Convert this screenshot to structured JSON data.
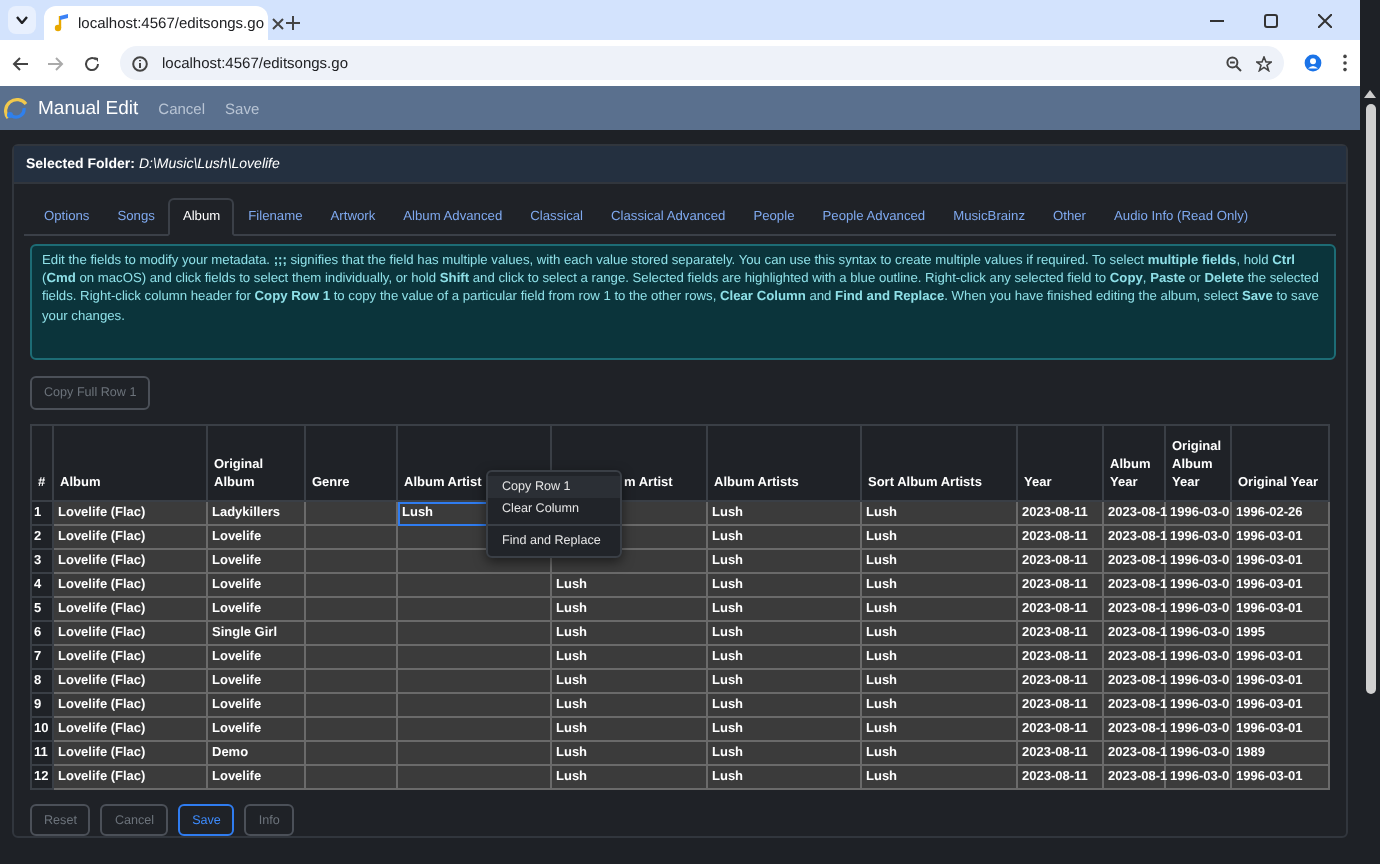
{
  "browser": {
    "tab_title": "localhost:4567/editsongs.go",
    "url": "localhost:4567/editsongs.go"
  },
  "app": {
    "title": "Manual Edit",
    "actions": [
      {
        "label": "Cancel"
      },
      {
        "label": "Save"
      }
    ]
  },
  "folder": {
    "label": "Selected Folder:",
    "path": "D:\\Music\\Lush\\Lovelife"
  },
  "tabs": [
    {
      "label": "Options",
      "selected": false
    },
    {
      "label": "Songs",
      "selected": false
    },
    {
      "label": "Album",
      "selected": true
    },
    {
      "label": "Filename",
      "selected": false
    },
    {
      "label": "Artwork",
      "selected": false
    },
    {
      "label": "Album Advanced",
      "selected": false
    },
    {
      "label": "Classical",
      "selected": false
    },
    {
      "label": "Classical Advanced",
      "selected": false
    },
    {
      "label": "People",
      "selected": false
    },
    {
      "label": "People Advanced",
      "selected": false
    },
    {
      "label": "MusicBrainz",
      "selected": false
    },
    {
      "label": "Other",
      "selected": false
    },
    {
      "label": "Audio Info (Read Only)",
      "selected": false
    }
  ],
  "info": "Edit the fields to modify your metadata. **;;;** signifies that the field has multiple values, with each value stored separately. You can use this syntax to create multiple values if required. To select **multiple fields**, hold **Ctrl** (**Cmd** on macOS) and click fields to select them individually, or hold **Shift** and click to select a range. Selected fields are highlighted with a blue outline. Right-click any selected field to **Copy**, **Paste** or **Delete** the selected fields. Right-click column header for **Copy Row 1** to copy the value of a particular field from row 1 to the other rows, **Clear Column** and **Find and Replace**. When you have finished editing the album, select **Save** to save your changes.",
  "copy_full_row_button": {
    "label": "Copy Full Row 1",
    "disabled": true
  },
  "table": {
    "number_header": "#",
    "columns": [
      "Album",
      "Original Album",
      "Genre",
      "Album Artist",
      "m Artist",
      "Album Artists",
      "Sort Album Artists",
      "Year",
      "Album Year",
      "Original Album Year",
      "Original Year"
    ],
    "rows": [
      {
        "number": "1",
        "cells": [
          {
            "text": "Lovelife  (Flac)",
            "selected": false
          },
          {
            "text": "Ladykillers",
            "selected": false
          },
          {
            "selected": false
          },
          {
            "text": "Lush",
            "selected": true
          },
          {
            "selected": false
          },
          {
            "text": "Lush",
            "selected": false
          },
          {
            "text": "Lush",
            "selected": false
          },
          {
            "text": "2023-08-11",
            "selected": false
          },
          {
            "text": "2023-08-1",
            "selected": false
          },
          {
            "text": "1996-03-0",
            "selected": false
          },
          {
            "text": "1996-02-26",
            "selected": false
          }
        ]
      },
      {
        "number": "2",
        "cells": [
          {
            "text": "Lovelife  (Flac)",
            "selected": false
          },
          {
            "text": "Lovelife",
            "selected": false
          },
          {
            "selected": false
          },
          {
            "selected": false
          },
          {
            "selected": false
          },
          {
            "text": "Lush",
            "selected": false
          },
          {
            "text": "Lush",
            "selected": false
          },
          {
            "text": "2023-08-11",
            "selected": false
          },
          {
            "text": "2023-08-1",
            "selected": false
          },
          {
            "text": "1996-03-0",
            "selected": false
          },
          {
            "text": "1996-03-01",
            "selected": false
          }
        ]
      },
      {
        "number": "3",
        "cells": [
          {
            "text": "Lovelife  (Flac)",
            "selected": false
          },
          {
            "text": "Lovelife",
            "selected": false
          },
          {
            "selected": false
          },
          {
            "selected": false
          },
          {
            "selected": false
          },
          {
            "text": "Lush",
            "selected": false
          },
          {
            "text": "Lush",
            "selected": false
          },
          {
            "text": "2023-08-11",
            "selected": false
          },
          {
            "text": "2023-08-1",
            "selected": false
          },
          {
            "text": "1996-03-0",
            "selected": false
          },
          {
            "text": "1996-03-01",
            "selected": false
          }
        ]
      },
      {
        "number": "4",
        "cells": [
          {
            "text": "Lovelife  (Flac)",
            "selected": false
          },
          {
            "text": "Lovelife",
            "selected": false
          },
          {
            "selected": false
          },
          {
            "selected": false
          },
          {
            "text": "Lush",
            "selected": false
          },
          {
            "text": "Lush",
            "selected": false
          },
          {
            "text": "Lush",
            "selected": false
          },
          {
            "text": "2023-08-11",
            "selected": false
          },
          {
            "text": "2023-08-1",
            "selected": false
          },
          {
            "text": "1996-03-0",
            "selected": false
          },
          {
            "text": "1996-03-01",
            "selected": false
          }
        ]
      },
      {
        "number": "5",
        "cells": [
          {
            "text": "Lovelife  (Flac)",
            "selected": false
          },
          {
            "text": "Lovelife",
            "selected": false
          },
          {
            "selected": false
          },
          {
            "selected": false
          },
          {
            "text": "Lush",
            "selected": false
          },
          {
            "text": "Lush",
            "selected": false
          },
          {
            "text": "Lush",
            "selected": false
          },
          {
            "text": "2023-08-11",
            "selected": false
          },
          {
            "text": "2023-08-1",
            "selected": false
          },
          {
            "text": "1996-03-0",
            "selected": false
          },
          {
            "text": "1996-03-01",
            "selected": false
          }
        ]
      },
      {
        "number": "6",
        "cells": [
          {
            "text": "Lovelife  (Flac)",
            "selected": false
          },
          {
            "text": "Single Girl",
            "selected": false
          },
          {
            "selected": false
          },
          {
            "selected": false
          },
          {
            "text": "Lush",
            "selected": false
          },
          {
            "text": "Lush",
            "selected": false
          },
          {
            "text": "Lush",
            "selected": false
          },
          {
            "text": "2023-08-11",
            "selected": false
          },
          {
            "text": "2023-08-1",
            "selected": false
          },
          {
            "text": "1996-03-0",
            "selected": false
          },
          {
            "text": "1995",
            "selected": false
          }
        ]
      },
      {
        "number": "7",
        "cells": [
          {
            "text": "Lovelife  (Flac)",
            "selected": false
          },
          {
            "text": "Lovelife",
            "selected": false
          },
          {
            "selected": false
          },
          {
            "selected": false
          },
          {
            "text": "Lush",
            "selected": false
          },
          {
            "text": "Lush",
            "selected": false
          },
          {
            "text": "Lush",
            "selected": false
          },
          {
            "text": "2023-08-11",
            "selected": false
          },
          {
            "text": "2023-08-1",
            "selected": false
          },
          {
            "text": "1996-03-0",
            "selected": false
          },
          {
            "text": "1996-03-01",
            "selected": false
          }
        ]
      },
      {
        "number": "8",
        "cells": [
          {
            "text": "Lovelife  (Flac)",
            "selected": false
          },
          {
            "text": "Lovelife",
            "selected": false
          },
          {
            "selected": false
          },
          {
            "selected": false
          },
          {
            "text": "Lush",
            "selected": false
          },
          {
            "text": "Lush",
            "selected": false
          },
          {
            "text": "Lush",
            "selected": false
          },
          {
            "text": "2023-08-11",
            "selected": false
          },
          {
            "text": "2023-08-1",
            "selected": false
          },
          {
            "text": "1996-03-0",
            "selected": false
          },
          {
            "text": "1996-03-01",
            "selected": false
          }
        ]
      },
      {
        "number": "9",
        "cells": [
          {
            "text": "Lovelife  (Flac)",
            "selected": false
          },
          {
            "text": "Lovelife",
            "selected": false
          },
          {
            "selected": false
          },
          {
            "selected": false
          },
          {
            "text": "Lush",
            "selected": false
          },
          {
            "text": "Lush",
            "selected": false
          },
          {
            "text": "Lush",
            "selected": false
          },
          {
            "text": "2023-08-11",
            "selected": false
          },
          {
            "text": "2023-08-1",
            "selected": false
          },
          {
            "text": "1996-03-0",
            "selected": false
          },
          {
            "text": "1996-03-01",
            "selected": false
          }
        ]
      },
      {
        "number": "10",
        "cells": [
          {
            "text": "Lovelife  (Flac)",
            "selected": false
          },
          {
            "text": "Lovelife",
            "selected": false
          },
          {
            "selected": false
          },
          {
            "selected": false
          },
          {
            "text": "Lush",
            "selected": false
          },
          {
            "text": "Lush",
            "selected": false
          },
          {
            "text": "Lush",
            "selected": false
          },
          {
            "text": "2023-08-11",
            "selected": false
          },
          {
            "text": "2023-08-1",
            "selected": false
          },
          {
            "text": "1996-03-0",
            "selected": false
          },
          {
            "text": "1996-03-01",
            "selected": false
          }
        ]
      },
      {
        "number": "11",
        "cells": [
          {
            "text": "Lovelife  (Flac)",
            "selected": false
          },
          {
            "text": "Demo",
            "selected": false
          },
          {
            "selected": false
          },
          {
            "selected": false
          },
          {
            "text": "Lush",
            "selected": false
          },
          {
            "text": "Lush",
            "selected": false
          },
          {
            "text": "Lush",
            "selected": false
          },
          {
            "text": "2023-08-11",
            "selected": false
          },
          {
            "text": "2023-08-1",
            "selected": false
          },
          {
            "text": "1996-03-0",
            "selected": false
          },
          {
            "text": "1989",
            "selected": false
          }
        ]
      },
      {
        "number": "12",
        "cells": [
          {
            "text": "Lovelife  (Flac)",
            "selected": false
          },
          {
            "text": "Lovelife",
            "selected": false
          },
          {
            "selected": false
          },
          {
            "selected": false
          },
          {
            "text": "Lush",
            "selected": false
          },
          {
            "text": "Lush",
            "selected": false
          },
          {
            "text": "Lush",
            "selected": false
          },
          {
            "text": "2023-08-11",
            "selected": false
          },
          {
            "text": "2023-08-1",
            "selected": false
          },
          {
            "text": "1996-03-0",
            "selected": false
          },
          {
            "text": "1996-03-01",
            "selected": false
          }
        ]
      }
    ]
  },
  "context_menu": {
    "items": [
      {
        "label": "Copy Row 1",
        "selected": true
      },
      {
        "label": "Clear Column",
        "selected": false
      },
      {
        "label": "Find and Replace",
        "selected": false
      }
    ]
  },
  "footer_buttons": [
    {
      "label": "Reset",
      "disabled": true
    },
    {
      "label": "Cancel",
      "disabled": true
    },
    {
      "label": "Save",
      "disabled": false
    },
    {
      "label": "Info",
      "disabled": true
    }
  ]
}
